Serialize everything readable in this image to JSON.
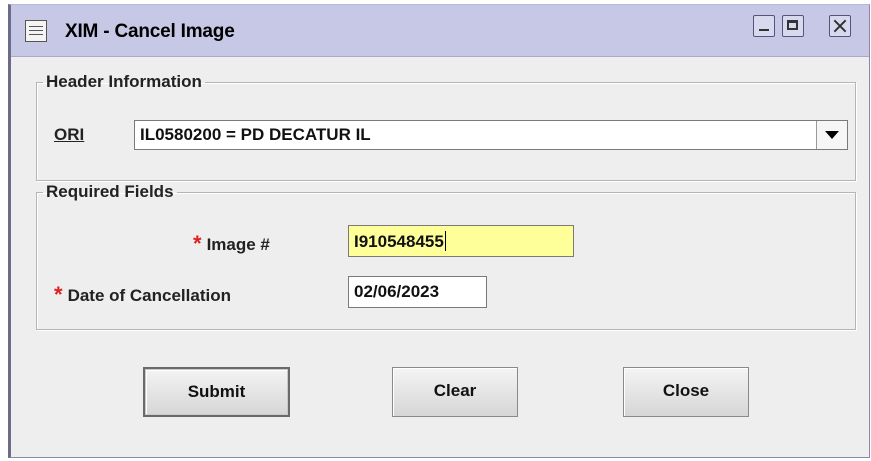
{
  "window": {
    "title": "XIM - Cancel Image",
    "icons": {
      "app": "window-menu-icon",
      "minimize": "minimize-icon",
      "maximize": "maximize-icon",
      "close": "close-icon"
    },
    "colors": {
      "titlebar": "#c7c8e6",
      "required_star": "#e02020",
      "focused_field": "#ffff99"
    }
  },
  "header_section": {
    "legend": "Header Information",
    "ori_label": "ORI",
    "ori_value": "IL0580200 = PD DECATUR IL"
  },
  "required_section": {
    "legend": "Required Fields",
    "required_marker": "*",
    "image_label": "Image #",
    "image_value": "I910548455",
    "date_label": "Date of Cancellation",
    "date_value": "02/06/2023"
  },
  "buttons": {
    "submit": "Submit",
    "clear": "Clear",
    "close": "Close"
  }
}
